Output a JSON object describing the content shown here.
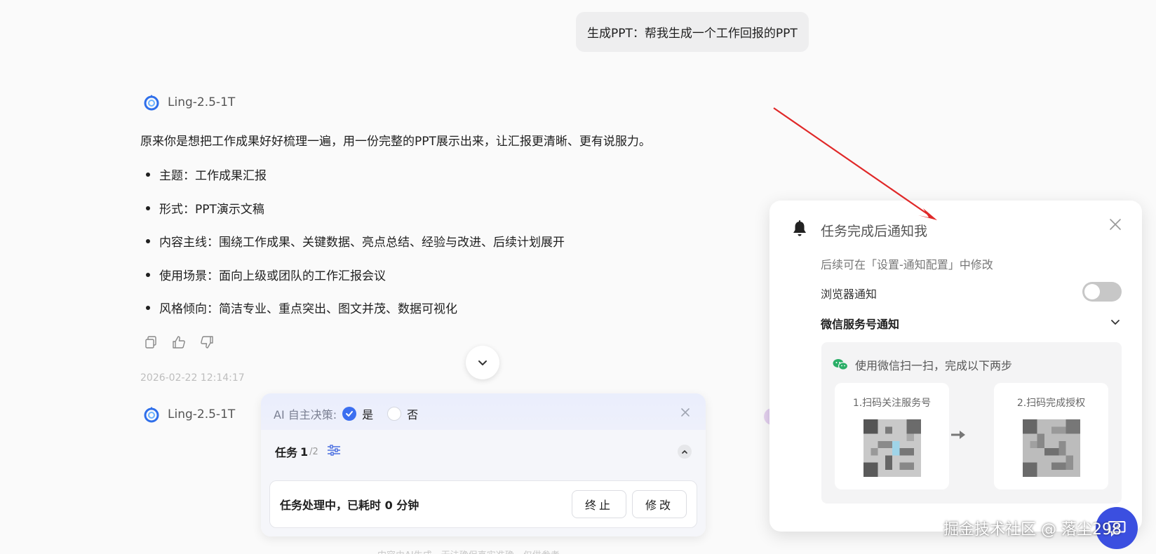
{
  "user_message": "生成PPT：帮我生成一个工作回报的PPT",
  "model_name": "Ling-2.5-1T",
  "answer": {
    "intro": "原来你是想把工作成果好好梳理一遍，用一份完整的PPT展示出来，让汇报更清晰、更有说服力。",
    "bullets": [
      "主题：工作成果汇报",
      "形式：PPT演示文稿",
      "内容主线：围绕工作成果、关键数据、亮点总结、经验与改进、后续计划展开",
      "使用场景：面向上级或团队的工作汇报会议",
      "风格倾向：简洁专业、重点突出、图文并茂、数据可视化"
    ]
  },
  "timestamp": "2026-02-22 12:14:17",
  "icons": {
    "copy": "copy-icon",
    "like": "thumbs-up-icon",
    "dislike": "thumbs-down-icon",
    "scroll": "chevron-down-icon",
    "bell": "bell-icon",
    "close": "close-icon",
    "wechat": "wechat-icon",
    "tune": "sliders-icon",
    "chat": "chat-bubble-icon"
  },
  "task_panel": {
    "ai_decide_label": "AI 自主决策:",
    "option_yes": "是",
    "option_no": "否",
    "selected": "是",
    "task_label": "任务",
    "task_current": "1",
    "task_total": "/2",
    "status_text": "任务处理中，已耗时 0 分钟",
    "stop_button": "终止",
    "edit_button": "修改"
  },
  "bottom_note": "内容由AI生成，无法确保真实准确，仅供参考",
  "notify_panel": {
    "title": "任务完成后通知我",
    "subtitle": "后续可在「设置-通知配置」中修改",
    "browser_notify": "浏览器通知",
    "browser_enabled": false,
    "wechat_notify": "微信服务号通知",
    "scan_hint": "使用微信扫一扫，完成以下两步",
    "step1": "1.扫码关注服务号",
    "step2": "2.扫码完成授权"
  },
  "watermark": "掘金技术社区 @ 落尘298",
  "colors": {
    "accent": "#3c6ff0",
    "annotation_arrow": "#e02828",
    "float_button": "#3b4fe0",
    "wechat_green": "#2aae67"
  }
}
